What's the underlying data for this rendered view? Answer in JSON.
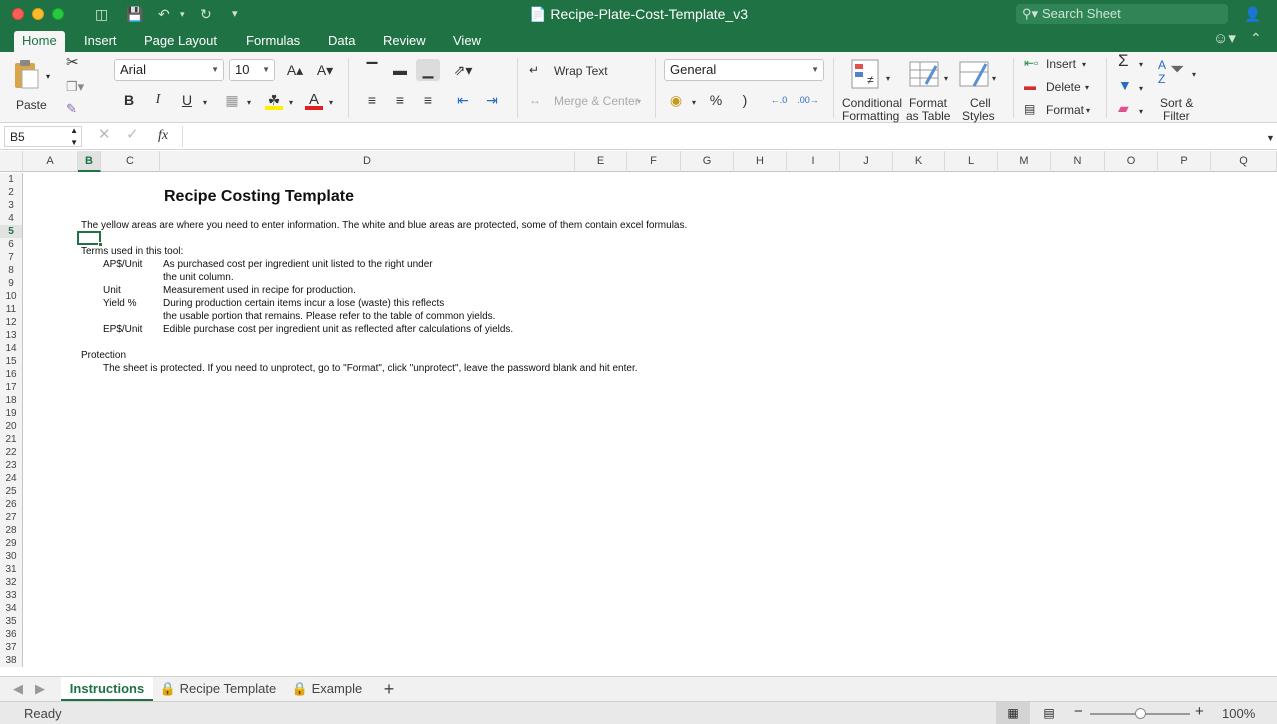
{
  "window": {
    "title": "Recipe-Plate-Cost-Template_v3",
    "search_placeholder": "Search Sheet"
  },
  "ribbon_tabs": [
    "Home",
    "Insert",
    "Page Layout",
    "Formulas",
    "Data",
    "Review",
    "View"
  ],
  "ribbon": {
    "paste_label": "Paste",
    "font_name": "Arial",
    "font_size": "10",
    "wrap_text_label": "Wrap Text",
    "merge_center_label": "Merge & Center",
    "number_format": "General",
    "percent_label": "%",
    "comma_label": ")",
    "conditional_formatting_label": "Conditional Formatting",
    "conditional_formatting_line1": "Conditional",
    "conditional_formatting_line2": "Formatting",
    "format_table_line1": "Format",
    "format_table_line2": "as Table",
    "cell_styles_line1": "Cell",
    "cell_styles_line2": "Styles",
    "insert_label": "Insert",
    "delete_label": "Delete",
    "format_label": "Format",
    "sort_line1": "Sort &",
    "sort_line2": "Filter",
    "bold_label": "B",
    "italic_label": "I",
    "underline_label": "U",
    "fx_label": "fx"
  },
  "formula_bar": {
    "name_box": "B5",
    "formula": ""
  },
  "columns": [
    "A",
    "B",
    "C",
    "D",
    "E",
    "F",
    "G",
    "H",
    "I",
    "J",
    "K",
    "L",
    "M",
    "N",
    "O",
    "P",
    "Q"
  ],
  "active_column": "B",
  "active_row": 5,
  "rows": [
    "1",
    "2",
    "3",
    "4",
    "5",
    "6",
    "7",
    "8",
    "9",
    "10",
    "11",
    "12",
    "13",
    "14",
    "15",
    "16",
    "17",
    "18",
    "19",
    "20",
    "21",
    "22",
    "23",
    "24",
    "25",
    "26",
    "27",
    "28",
    "29",
    "30",
    "31",
    "32",
    "33",
    "34",
    "35",
    "36",
    "37",
    "38"
  ],
  "content": {
    "title": "Recipe Costing Template",
    "intro": "The yellow areas are where you need to enter information.  The white and blue areas are protected, some of them contain excel formulas.",
    "terms_heading": "Terms used in this tool:",
    "terms": [
      {
        "term": "AP$/Unit",
        "lines": [
          "As purchased cost per ingredient unit listed to the right under",
          "the unit column."
        ]
      },
      {
        "term": "Unit",
        "lines": [
          "Measurement used in recipe for production."
        ]
      },
      {
        "term": "Yield %",
        "lines": [
          "During production certain items incur a lose (waste) this reflects",
          "the usable portion that remains. Please refer to the table of common yields."
        ]
      },
      {
        "term": "EP$/Unit",
        "lines": [
          "Edible purchase cost per ingredient unit as reflected after calculations of yields."
        ]
      }
    ],
    "protection_heading": "Protection",
    "protection_text": "The sheet is protected.  If you need to unprotect, go to \"Format\", click \"unprotect\", leave the password blank and hit enter."
  },
  "sheet_tabs": [
    {
      "label": "Instructions",
      "active": true,
      "locked": false
    },
    {
      "label": "Recipe Template",
      "active": false,
      "locked": true
    },
    {
      "label": "Example",
      "active": false,
      "locked": true
    }
  ],
  "status": {
    "text": "Ready",
    "zoom": "100%",
    "zoom_level_percent": 100
  },
  "colors": {
    "accent": "#1f7244",
    "fill_color": "#ffef00",
    "font_color": "#e02020"
  }
}
